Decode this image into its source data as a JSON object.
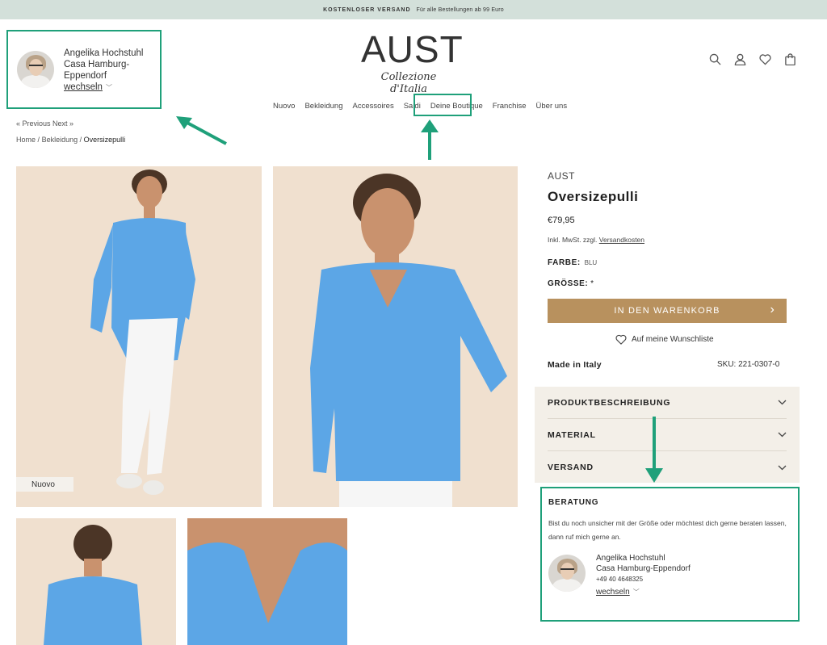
{
  "topbar": {
    "highlight": "KOSTENLOSER VERSAND",
    "text": "Für alle Bestellungen ab 99 Euro"
  },
  "store": {
    "name": "Angelika Hochstuhl",
    "location_line1": "Casa Hamburg-",
    "location_line2": "Eppendorf",
    "switch": "wechseln"
  },
  "logo": {
    "main": "AUST",
    "sub": "Collezione d'Italia"
  },
  "nav": {
    "items": [
      "Nuovo",
      "Bekleidung",
      "Accessoires",
      "Saldi",
      "Deine Boutique",
      "Franchise",
      "Über uns"
    ]
  },
  "icons": {
    "search": "search-icon",
    "account": "user-icon",
    "wishlist": "heart-icon",
    "cart": "bag-icon"
  },
  "breadcrumb": {
    "prev_next": "« Previous Next »",
    "home": "Home",
    "sep": "/",
    "category": "Bekleidung",
    "current": "Oversizepulli"
  },
  "gallery": {
    "badge": "Nuovo"
  },
  "product": {
    "brand": "AUST",
    "title": "Oversizepulli",
    "price": "€79,95",
    "tax_text": "Inkl. MwSt. zzgl.",
    "shipping_link": "Versandkosten",
    "color_label": "FARBE:",
    "color_value": "BLU",
    "size_label": "GRÖSSE:",
    "size_required": "*",
    "cart_button": "IN DEN WARENKORB",
    "wishlist": "Auf meine Wunschliste",
    "made_in": "Made in Italy",
    "sku": "SKU: 221-0307-0"
  },
  "accordion": {
    "items": [
      "PRODUKTBESCHREIBUNG",
      "MATERIAL",
      "VERSAND"
    ]
  },
  "beratung": {
    "title": "BERATUNG",
    "text": "Bist du noch unsicher mit der Größe oder möchtest dich gerne beraten lassen, dann ruf mich gerne an.",
    "name": "Angelika Hochstuhl",
    "location": "Casa Hamburg-Eppendorf",
    "phone": "+49 40 4648325",
    "switch": "wechseln"
  },
  "colors": {
    "accent_green": "#1fa07a",
    "cart_button": "#b8915e",
    "topbar": "#d3e0da",
    "accordion_bg": "#f3efe8"
  }
}
